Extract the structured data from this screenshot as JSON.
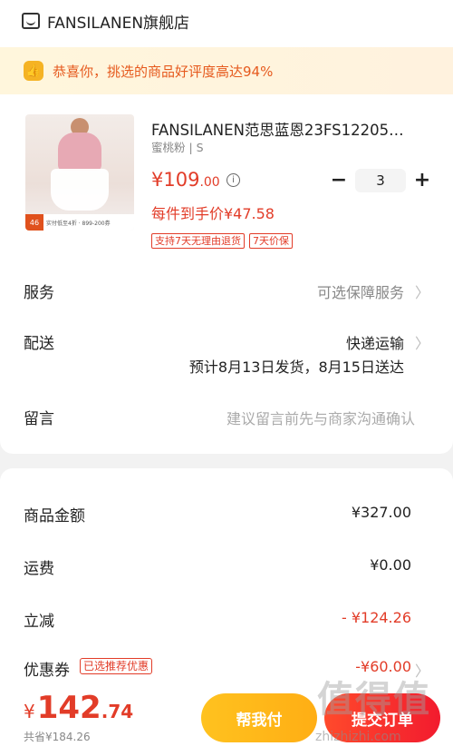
{
  "store": {
    "name": "FANSILANEN旗舰店",
    "icon": "store-icon"
  },
  "banner": {
    "text": "恭喜你，挑选的商品好评度高达94%",
    "icon": "thumbs-up-icon"
  },
  "product": {
    "title": "FANSILANEN范思蓝恩23FS12205…",
    "spec": "蜜桃粉 | S",
    "price_int": "¥109",
    "price_dec": ".00",
    "each_price": "每件到手价¥47.58",
    "quantity": "3",
    "minus": "−",
    "plus": "+",
    "tags": [
      "支持7天无理由退货",
      "7天价保"
    ],
    "image_tag": {
      "badge": "46",
      "text": "实付低至4折 · 899-200券"
    }
  },
  "rows": {
    "service": {
      "label": "服务",
      "value": "可选保障服务"
    },
    "delivery": {
      "label": "配送",
      "value": "快递运输",
      "eta": "预计8月13日发货，8月15日送达"
    },
    "note": {
      "label": "留言",
      "placeholder": "建议留言前先与商家沟通确认"
    }
  },
  "summary": {
    "goods": {
      "label": "商品金额",
      "value": "¥327.00"
    },
    "shipping": {
      "label": "运费",
      "value": "¥0.00"
    },
    "discount": {
      "label": "立减",
      "value": "- ¥124.26"
    },
    "coupon": {
      "label": "优惠券",
      "pill": "已选推荐优惠",
      "value": "-¥60.00"
    }
  },
  "footer": {
    "currency": "¥",
    "total_int": "142",
    "total_dec": ".74",
    "saved": "共省¥184.26",
    "help_pay": "帮我付",
    "pay": "提交订单"
  },
  "watermark": {
    "logo": "值得值",
    "url": "zhizhizhi.com"
  },
  "colors": {
    "accent": "#e23c28",
    "help": "#ffb81a",
    "pay": "#f4242c"
  }
}
